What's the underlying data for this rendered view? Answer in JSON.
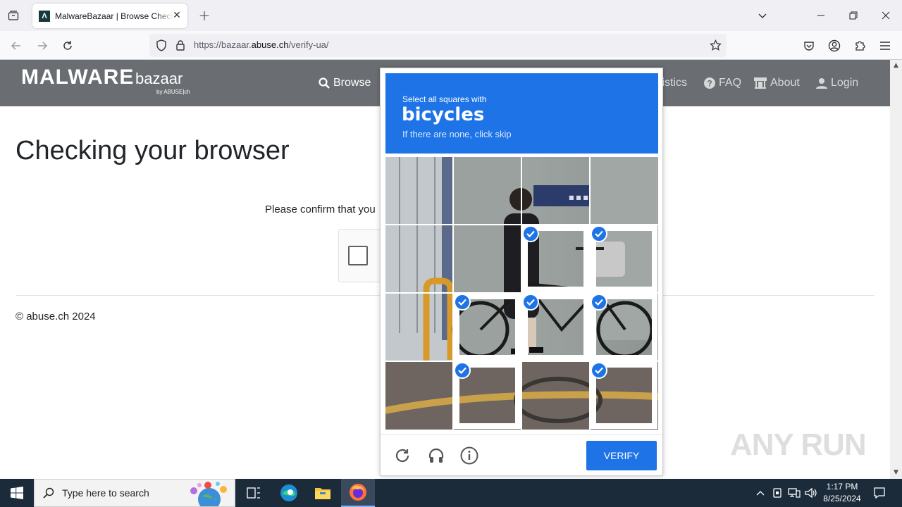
{
  "browser": {
    "tab_title": "MalwareBazaar | Browse Checking your browser",
    "tab_favicon_letter": "Λ",
    "url_prefix": "https://bazaar.",
    "url_host": "abuse.ch",
    "url_path": "/verify-ua/"
  },
  "site": {
    "logo_main": "MALWARE",
    "logo_sub": "bazaar",
    "logo_by": "by ABUSE|ch",
    "menu": [
      {
        "label": "Browse",
        "icon": "search-icon"
      },
      {
        "label": "tistics",
        "icon": "stats-icon"
      },
      {
        "label": "FAQ",
        "icon": "question-icon"
      },
      {
        "label": "About",
        "icon": "building-icon"
      },
      {
        "label": "Login",
        "icon": "user-icon"
      }
    ],
    "page_title": "Checking your browser",
    "confirm_text": "Please confirm that you",
    "footer": "© abuse.ch 2024",
    "watermark": "ANY RUN"
  },
  "challenge": {
    "prompt_top": "Select all squares with",
    "prompt_main": "bicycles",
    "prompt_sub": "If there are none, click skip",
    "verify_label": "VERIFY",
    "selected_cells": [
      6,
      7,
      9,
      10,
      11,
      13,
      15
    ],
    "footer_icons": [
      "refresh-icon",
      "headphones-icon",
      "info-icon"
    ]
  },
  "taskbar": {
    "search_placeholder": "Type here to search",
    "time": "1:17 PM",
    "date": "8/25/2024"
  }
}
